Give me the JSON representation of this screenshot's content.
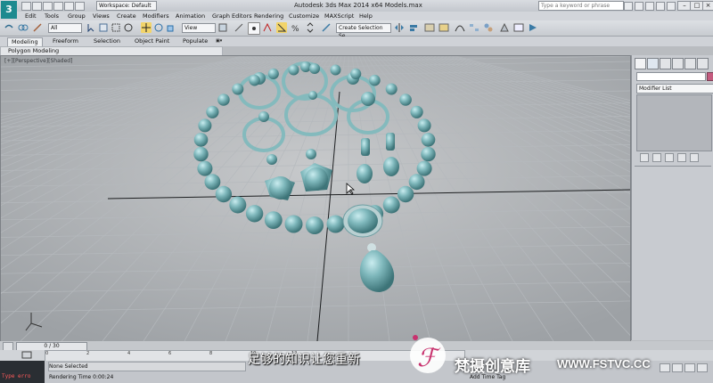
{
  "app": {
    "title": "Autodesk 3ds Max  2014 x64     Models.max",
    "workspace": "Workspace: Default",
    "search_placeholder": "Type a keyword or phrase"
  },
  "menu": [
    "Edit",
    "Tools",
    "Group",
    "Views",
    "Create",
    "Modifiers",
    "Animation",
    "Graph Editors",
    "Rendering",
    "Customize",
    "MAXScript",
    "Help"
  ],
  "toolbar": {
    "filter": "All",
    "coord": "View",
    "selection_set": "Create Selection Se"
  },
  "ribbon": {
    "tabs": [
      "Modeling",
      "Freeform",
      "Selection",
      "Object Paint",
      "Populate"
    ],
    "sub": "Polygon Modeling"
  },
  "viewport": {
    "label": "[+][Perspective][Shaded]"
  },
  "command_panel": {
    "modifier_list": "Modifier List"
  },
  "timeline": {
    "frame": "0 / 30",
    "ticks": [
      "0",
      "2",
      "4",
      "6",
      "8",
      "10",
      "12"
    ]
  },
  "status": {
    "selection": "None Selected",
    "render_time": "Rendering Time  0:00:24",
    "add_time_tag": "Add Time Tag",
    "listener": "Type erro"
  },
  "overlay": {
    "subtitle": "足够的知识让您重新",
    "brand": "梵摄创意库",
    "site": "WWW.FSTVC.CC"
  },
  "colors": {
    "jewel": "#7fb8bc",
    "accent": "#c45b7f",
    "grid": "#b0b4b8"
  }
}
